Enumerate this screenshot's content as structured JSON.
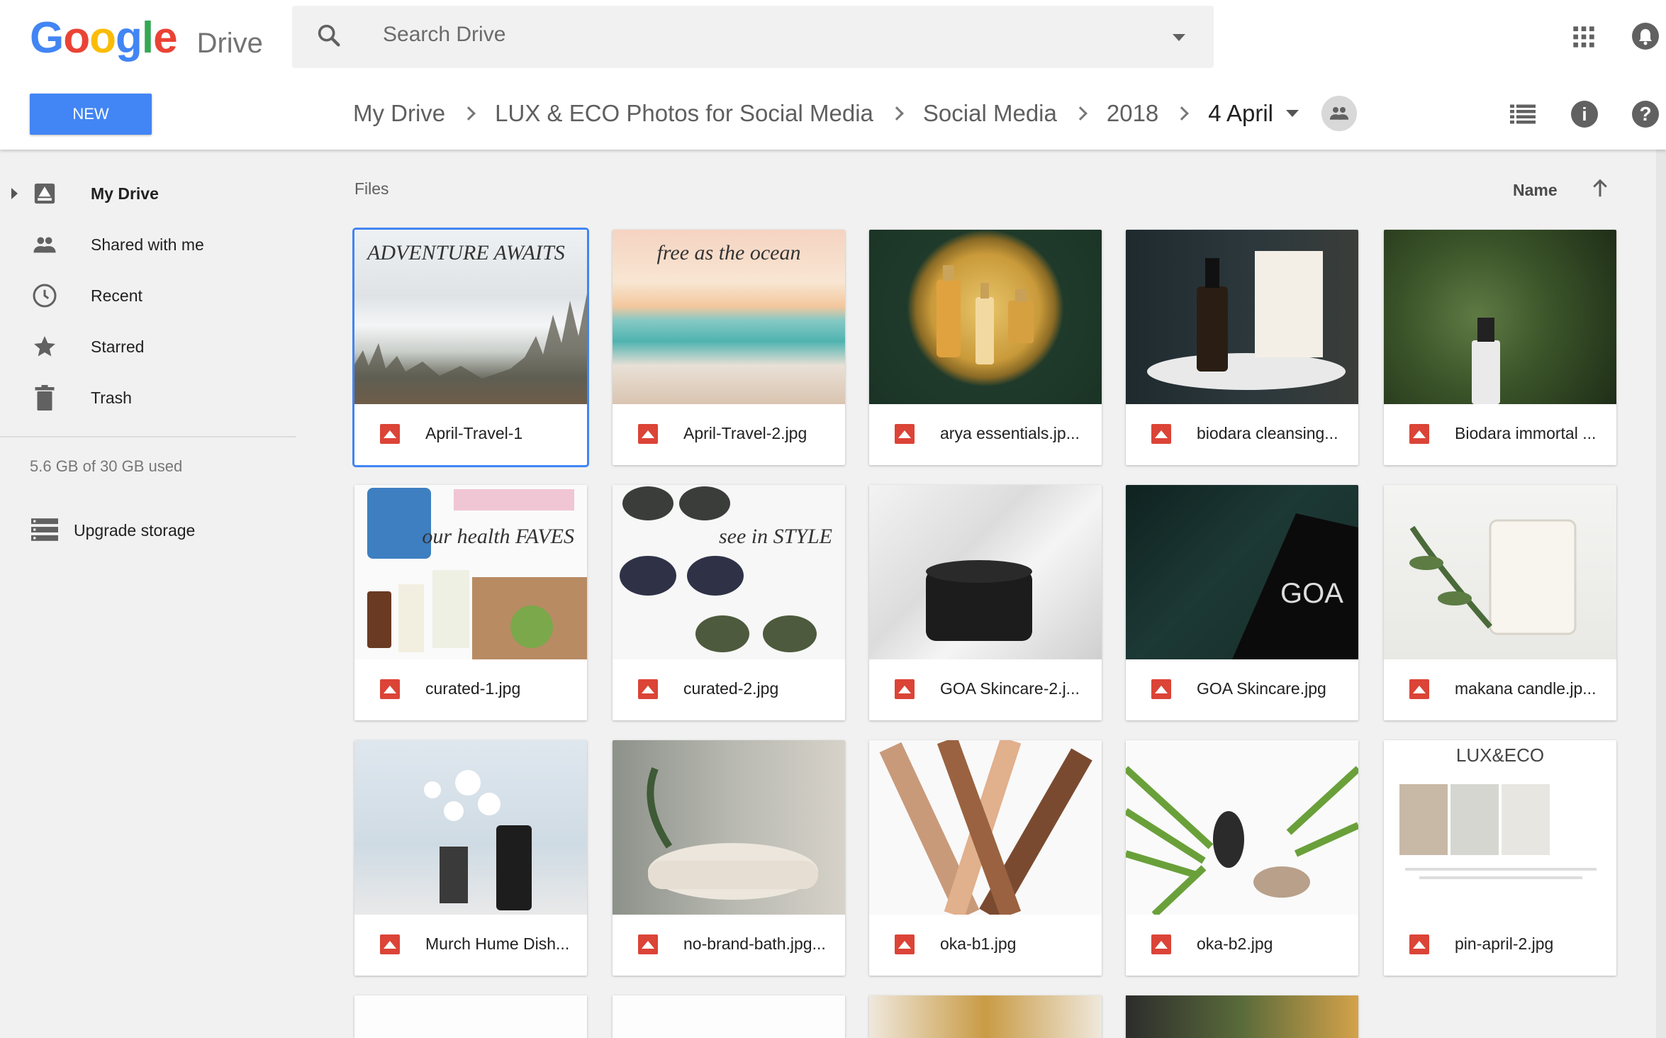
{
  "app": {
    "logo_google": "Google",
    "logo_product": "Drive",
    "logo_colors": [
      "#4285f4",
      "#ea4335",
      "#fbbc05",
      "#4285f4",
      "#34a853",
      "#ea4335"
    ]
  },
  "search": {
    "placeholder": "Search Drive"
  },
  "new_button": {
    "label": "NEW",
    "color": "#4285f4"
  },
  "breadcrumb": {
    "items": [
      "My Drive",
      "LUX & ECO Photos for Social Media",
      "Social Media",
      "2018"
    ],
    "current": "4 April"
  },
  "sidebar": {
    "items": [
      {
        "label": "My Drive",
        "icon": "drive-icon"
      },
      {
        "label": "Shared with me",
        "icon": "people-icon"
      },
      {
        "label": "Recent",
        "icon": "clock-icon"
      },
      {
        "label": "Starred",
        "icon": "star-icon"
      },
      {
        "label": "Trash",
        "icon": "trash-icon"
      }
    ],
    "storage": "5.6 GB of 30 GB used",
    "upgrade": "Upgrade storage"
  },
  "main": {
    "section_label": "Files",
    "sort_label": "Name"
  },
  "files": [
    {
      "name": "April-Travel-1",
      "overlay": "ADVENTURE AWAITS",
      "selected": true
    },
    {
      "name": "April-Travel-2.jpg",
      "overlay": "free as the ocean"
    },
    {
      "name": "arya essentials.jp...",
      "overlay": ""
    },
    {
      "name": "biodara cleansing...",
      "overlay": ""
    },
    {
      "name": "Biodara immortal ...",
      "overlay": ""
    },
    {
      "name": "curated-1.jpg",
      "overlay": "our health FAVES"
    },
    {
      "name": "curated-2.jpg",
      "overlay": "see in STYLE"
    },
    {
      "name": "GOA Skincare-2.j...",
      "overlay": ""
    },
    {
      "name": "GOA Skincare.jpg",
      "overlay": "GOA"
    },
    {
      "name": "makana candle.jp...",
      "overlay": ""
    },
    {
      "name": "Murch Hume Dish...",
      "overlay": ""
    },
    {
      "name": "no-brand-bath.jpg...",
      "overlay": ""
    },
    {
      "name": "oka-b1.jpg",
      "overlay": ""
    },
    {
      "name": "oka-b2.jpg",
      "overlay": ""
    },
    {
      "name": "pin-april-2.jpg",
      "overlay": "LUX&ECO"
    }
  ]
}
